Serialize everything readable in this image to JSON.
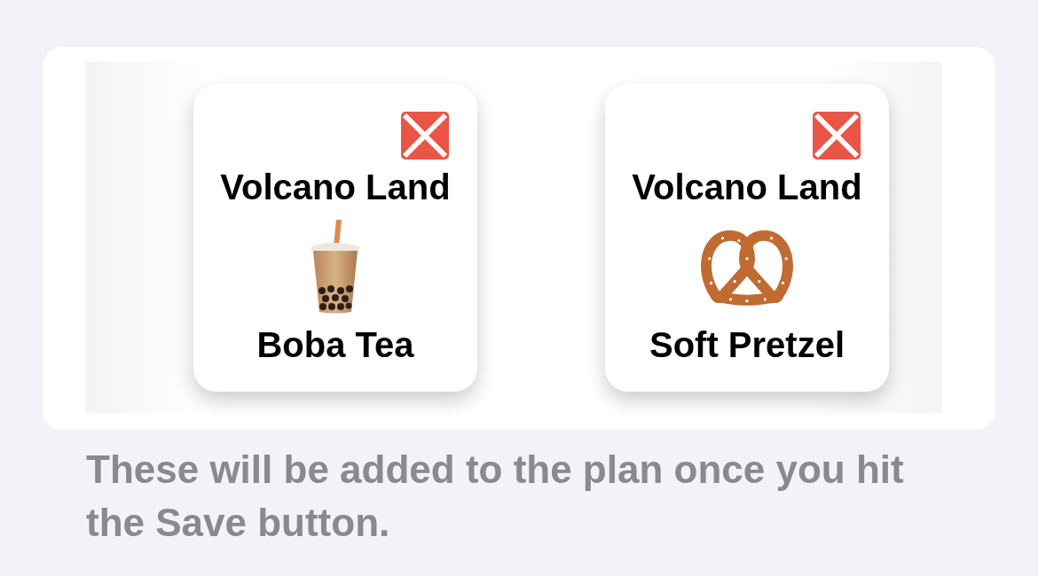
{
  "items": [
    {
      "area": "Volcano Land",
      "name": "Boba Tea",
      "kind": "drink"
    },
    {
      "area": "Volcano Land",
      "name": "Soft Pretzel",
      "kind": "snack"
    }
  ],
  "footnote": "These will be added to the plan once you hit the Save button."
}
